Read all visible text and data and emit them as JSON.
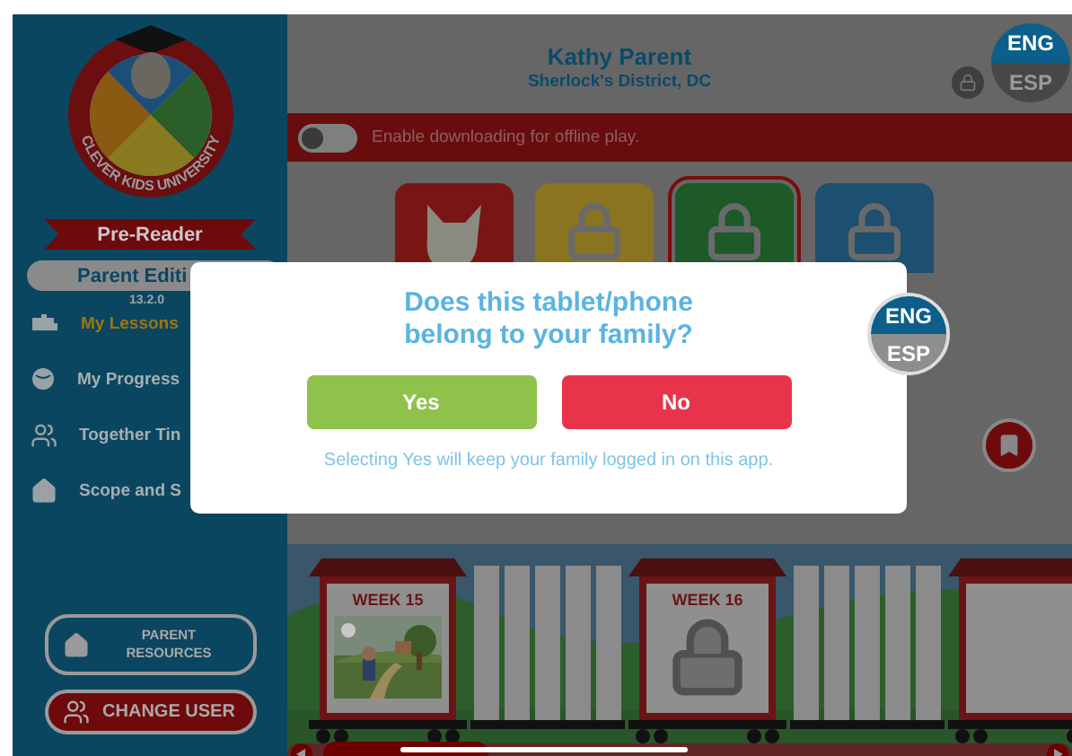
{
  "sidebar": {
    "logo_text": "CLEVER KIDS UNIVERSITY",
    "level": "Pre-Reader",
    "edition": "Parent Editi",
    "version": "13.2.0",
    "menu": [
      {
        "kind": "train",
        "label": "My Lessons",
        "selected": true
      },
      {
        "kind": "progress",
        "label": "My Progress",
        "selected": false
      },
      {
        "kind": "together",
        "label": "Together Tin",
        "selected": false
      },
      {
        "kind": "scope",
        "label": "Scope and S",
        "selected": false
      }
    ],
    "buttons": [
      {
        "kind": "resources",
        "label": "PARENT RESOURCES"
      },
      {
        "kind": "user",
        "label": "CHANGE USER"
      }
    ]
  },
  "header": {
    "name": "Kathy Parent",
    "district": "Sherlock's District, DC",
    "languages": [
      "ENG",
      "ESP"
    ]
  },
  "offline": {
    "label": "Enable downloading for offline play.",
    "on": false
  },
  "tiles": [
    {
      "kind": "character",
      "selected": false
    },
    {
      "kind": "locked",
      "selected": false
    },
    {
      "kind": "locked",
      "selected": true
    },
    {
      "kind": "locked",
      "selected": false
    }
  ],
  "train": [
    {
      "kind": "picture",
      "label": "WEEK 15"
    },
    {
      "kind": "locked",
      "label": "WEEK 16"
    },
    {
      "kind": "cut"
    }
  ],
  "dialog": {
    "title": "Does this tablet/phone belong to your family?",
    "yes": "Yes",
    "no": "No",
    "note": "Selecting Yes will keep your family logged in on this app.",
    "languages": [
      "ENG",
      "ESP"
    ]
  }
}
